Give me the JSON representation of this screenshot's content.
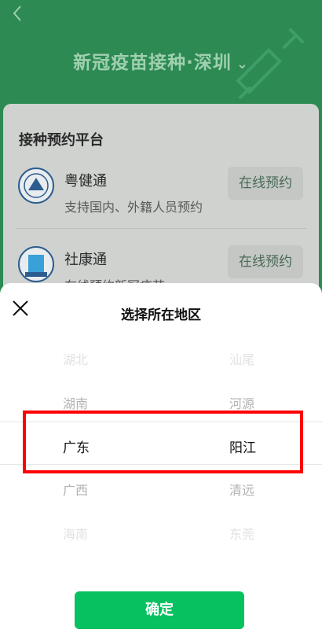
{
  "header": {
    "title": "新冠疫苗接种·深圳",
    "dropdown_icon": "chevron-down-icon",
    "back_icon": "back-chevron-icon"
  },
  "platform_card": {
    "title": "接种预约平台",
    "items": [
      {
        "name": "粤健通",
        "desc": "支持国内、外籍人员预约",
        "button": "在线预约"
      },
      {
        "name": "社康通",
        "desc": "在线预约新冠疫苗",
        "button": "在线预约"
      }
    ]
  },
  "region_picker": {
    "title": "选择所在地区",
    "provinces": [
      "湖北",
      "湖南",
      "广东",
      "广西",
      "海南"
    ],
    "cities": [
      "汕尾",
      "河源",
      "阳江",
      "清远",
      "东莞"
    ],
    "selected_province": "广东",
    "selected_city": "阳江",
    "confirm_label": "确定"
  },
  "colors": {
    "brand_green": "#07c160",
    "header_green": "#2c8a52",
    "highlight": "#ff0000"
  }
}
